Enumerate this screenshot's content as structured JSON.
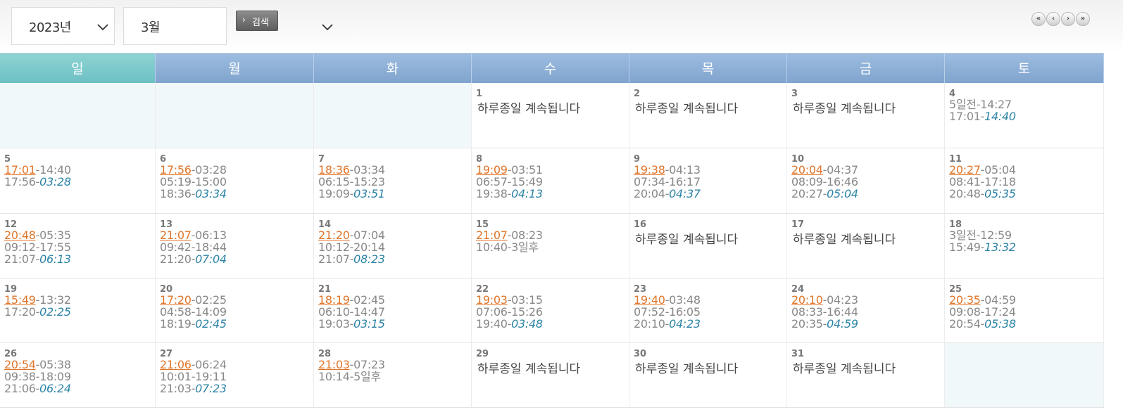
{
  "toolbar": {
    "year_select": "2023년",
    "month_select": "3월",
    "search_label": "검색",
    "nav": [
      "«",
      "‹",
      "›",
      "»"
    ]
  },
  "weekdays": [
    "일",
    "월",
    "화",
    "수",
    "목",
    "금",
    "토"
  ],
  "allday_text": "하루종일 계속됩니다",
  "weeks": [
    [
      {
        "blank": true
      },
      {
        "blank": true
      },
      {
        "blank": true
      },
      {
        "day": "1",
        "allday": true
      },
      {
        "day": "2",
        "allday": true
      },
      {
        "day": "3",
        "allday": true
      },
      {
        "day": "4",
        "lines": [
          [
            {
              "t": "5일전-14:27"
            }
          ],
          [
            {
              "t": "17:01-"
            },
            {
              "t": "14:40",
              "s": "it"
            }
          ]
        ]
      }
    ],
    [
      {
        "day": "5",
        "lines": [
          [
            {
              "t": "17:01",
              "s": "rise"
            },
            {
              "t": "-14:40"
            }
          ],
          [
            {
              "t": "17:56-"
            },
            {
              "t": "03:28",
              "s": "it"
            }
          ]
        ]
      },
      {
        "day": "6",
        "lines": [
          [
            {
              "t": "17:56",
              "s": "rise"
            },
            {
              "t": "-03:28"
            }
          ],
          [
            {
              "t": "05:19-15:00"
            }
          ],
          [
            {
              "t": "18:36-"
            },
            {
              "t": "03:34",
              "s": "it"
            }
          ]
        ]
      },
      {
        "day": "7",
        "lines": [
          [
            {
              "t": "18:36",
              "s": "rise"
            },
            {
              "t": "-03:34"
            }
          ],
          [
            {
              "t": "06:15-15:23"
            }
          ],
          [
            {
              "t": "19:09-"
            },
            {
              "t": "03:51",
              "s": "it"
            }
          ]
        ]
      },
      {
        "day": "8",
        "lines": [
          [
            {
              "t": "19:09",
              "s": "rise"
            },
            {
              "t": "-03:51"
            }
          ],
          [
            {
              "t": "06:57-15:49"
            }
          ],
          [
            {
              "t": "19:38-"
            },
            {
              "t": "04:13",
              "s": "it"
            }
          ]
        ]
      },
      {
        "day": "9",
        "lines": [
          [
            {
              "t": "19:38",
              "s": "rise"
            },
            {
              "t": "-04:13"
            }
          ],
          [
            {
              "t": "07:34-16:17"
            }
          ],
          [
            {
              "t": "20:04-"
            },
            {
              "t": "04:37",
              "s": "it"
            }
          ]
        ]
      },
      {
        "day": "10",
        "lines": [
          [
            {
              "t": "20:04",
              "s": "rise"
            },
            {
              "t": "-04:37"
            }
          ],
          [
            {
              "t": "08:09-16:46"
            }
          ],
          [
            {
              "t": "20:27-"
            },
            {
              "t": "05:04",
              "s": "it"
            }
          ]
        ]
      },
      {
        "day": "11",
        "lines": [
          [
            {
              "t": "20:27",
              "s": "rise"
            },
            {
              "t": "-05:04"
            }
          ],
          [
            {
              "t": "08:41-17:18"
            }
          ],
          [
            {
              "t": "20:48-"
            },
            {
              "t": "05:35",
              "s": "it"
            }
          ]
        ]
      }
    ],
    [
      {
        "day": "12",
        "lines": [
          [
            {
              "t": "20:48",
              "s": "rise"
            },
            {
              "t": "-05:35"
            }
          ],
          [
            {
              "t": "09:12-17:55"
            }
          ],
          [
            {
              "t": "21:07-"
            },
            {
              "t": "06:13",
              "s": "it"
            }
          ]
        ]
      },
      {
        "day": "13",
        "lines": [
          [
            {
              "t": "21:07",
              "s": "rise"
            },
            {
              "t": "-06:13"
            }
          ],
          [
            {
              "t": "09:42-18:44"
            }
          ],
          [
            {
              "t": "21:20-"
            },
            {
              "t": "07:04",
              "s": "it"
            }
          ]
        ]
      },
      {
        "day": "14",
        "lines": [
          [
            {
              "t": "21:20",
              "s": "rise"
            },
            {
              "t": "-07:04"
            }
          ],
          [
            {
              "t": "10:12-20:14"
            }
          ],
          [
            {
              "t": "21:07-"
            },
            {
              "t": "08:23",
              "s": "it"
            }
          ]
        ]
      },
      {
        "day": "15",
        "lines": [
          [
            {
              "t": "21:07",
              "s": "rise"
            },
            {
              "t": "-08:23"
            }
          ],
          [
            {
              "t": "10:40-3일후"
            }
          ]
        ]
      },
      {
        "day": "16",
        "allday": true
      },
      {
        "day": "17",
        "allday": true
      },
      {
        "day": "18",
        "lines": [
          [
            {
              "t": "3일전-12:59"
            }
          ],
          [
            {
              "t": "15:49-"
            },
            {
              "t": "13:32",
              "s": "it"
            }
          ]
        ]
      }
    ],
    [
      {
        "day": "19",
        "lines": [
          [
            {
              "t": "15:49",
              "s": "rise"
            },
            {
              "t": "-13:32"
            }
          ],
          [
            {
              "t": "17:20-"
            },
            {
              "t": "02:25",
              "s": "it"
            }
          ]
        ]
      },
      {
        "day": "20",
        "lines": [
          [
            {
              "t": "17:20",
              "s": "rise"
            },
            {
              "t": "-02:25"
            }
          ],
          [
            {
              "t": "04:58-14:09"
            }
          ],
          [
            {
              "t": "18:19-"
            },
            {
              "t": "02:45",
              "s": "it"
            }
          ]
        ]
      },
      {
        "day": "21",
        "lines": [
          [
            {
              "t": "18:19",
              "s": "rise"
            },
            {
              "t": "-02:45"
            }
          ],
          [
            {
              "t": "06:10-14:47"
            }
          ],
          [
            {
              "t": "19:03-"
            },
            {
              "t": "03:15",
              "s": "it"
            }
          ]
        ]
      },
      {
        "day": "22",
        "lines": [
          [
            {
              "t": "19:03",
              "s": "rise"
            },
            {
              "t": "-03:15"
            }
          ],
          [
            {
              "t": "07:06-15:26"
            }
          ],
          [
            {
              "t": "19:40-"
            },
            {
              "t": "03:48",
              "s": "it"
            }
          ]
        ]
      },
      {
        "day": "23",
        "lines": [
          [
            {
              "t": "19:40",
              "s": "rise"
            },
            {
              "t": "-03:48"
            }
          ],
          [
            {
              "t": "07:52-16:05"
            }
          ],
          [
            {
              "t": "20:10-"
            },
            {
              "t": "04:23",
              "s": "it"
            }
          ]
        ]
      },
      {
        "day": "24",
        "lines": [
          [
            {
              "t": "20:10",
              "s": "rise"
            },
            {
              "t": "-04:23"
            }
          ],
          [
            {
              "t": "08:33-16:44"
            }
          ],
          [
            {
              "t": "20:35-"
            },
            {
              "t": "04:59",
              "s": "it"
            }
          ]
        ]
      },
      {
        "day": "25",
        "lines": [
          [
            {
              "t": "20:35",
              "s": "rise"
            },
            {
              "t": "-04:59"
            }
          ],
          [
            {
              "t": "09:08-17:24"
            }
          ],
          [
            {
              "t": "20:54-"
            },
            {
              "t": "05:38",
              "s": "it"
            }
          ]
        ]
      }
    ],
    [
      {
        "day": "26",
        "lines": [
          [
            {
              "t": "20:54",
              "s": "rise"
            },
            {
              "t": "-05:38"
            }
          ],
          [
            {
              "t": "09:38-18:09"
            }
          ],
          [
            {
              "t": "21:06-"
            },
            {
              "t": "06:24",
              "s": "it"
            }
          ]
        ]
      },
      {
        "day": "27",
        "lines": [
          [
            {
              "t": "21:06",
              "s": "rise"
            },
            {
              "t": "-06:24"
            }
          ],
          [
            {
              "t": "10:01-19:11"
            }
          ],
          [
            {
              "t": "21:03-"
            },
            {
              "t": "07:23",
              "s": "it"
            }
          ]
        ]
      },
      {
        "day": "28",
        "lines": [
          [
            {
              "t": "21:03",
              "s": "rise"
            },
            {
              "t": "-07:23"
            }
          ],
          [
            {
              "t": "10:14-5일후"
            }
          ]
        ]
      },
      {
        "day": "29",
        "allday": true
      },
      {
        "day": "30",
        "allday": true
      },
      {
        "day": "31",
        "allday": true
      },
      {
        "blank": true
      }
    ]
  ]
}
